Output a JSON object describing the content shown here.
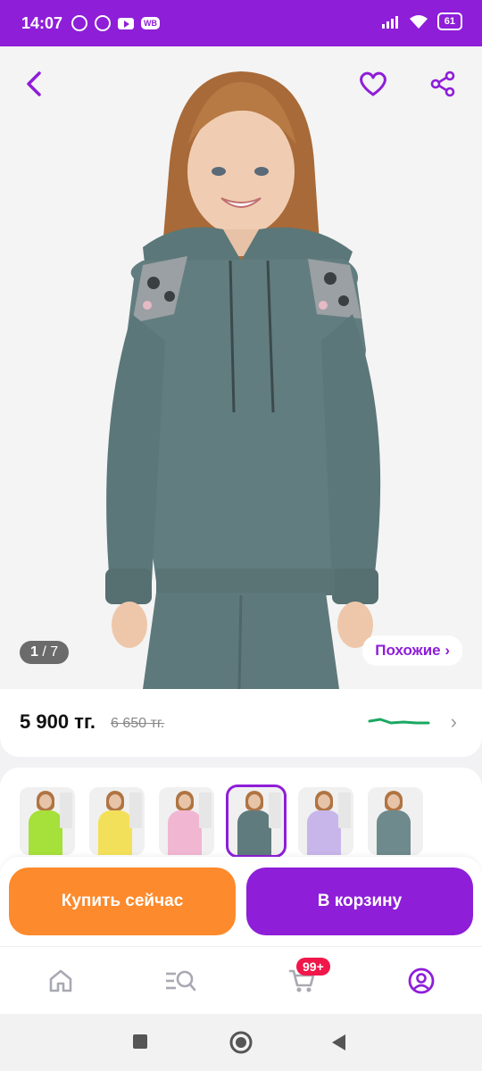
{
  "status_bar": {
    "time": "14:07",
    "wb_badge": "WB",
    "battery": "61"
  },
  "gallery": {
    "current": "1",
    "total": "7",
    "similar_label": "Похожие ›"
  },
  "icons": {
    "back": "back-arrow-icon",
    "favorite": "heart-icon",
    "share": "share-icon"
  },
  "price_card": {
    "price": "5 900 тг.",
    "old_price": "6 650 тг."
  },
  "variants": [
    {
      "color": "#a6e03a",
      "selected": false
    },
    {
      "color": "#f3e05a",
      "selected": false
    },
    {
      "color": "#f1b6d2",
      "selected": false
    },
    {
      "color": "#5f7b7d",
      "selected": true
    },
    {
      "color": "#c8b6ea",
      "selected": false
    },
    {
      "color": "#6f8a8c",
      "selected": false
    }
  ],
  "actions": {
    "buy_now": "Купить сейчас",
    "add_to_cart": "В корзину"
  },
  "bottom_nav": {
    "cart_badge": "99+",
    "items": [
      "home-icon",
      "catalog-search-icon",
      "cart-icon",
      "profile-icon"
    ]
  },
  "colors": {
    "brand_purple": "#8e1ed8",
    "buy_orange": "#fd8a2c",
    "badge_red": "#f0174a",
    "price_trend_green": "#1aa861"
  }
}
